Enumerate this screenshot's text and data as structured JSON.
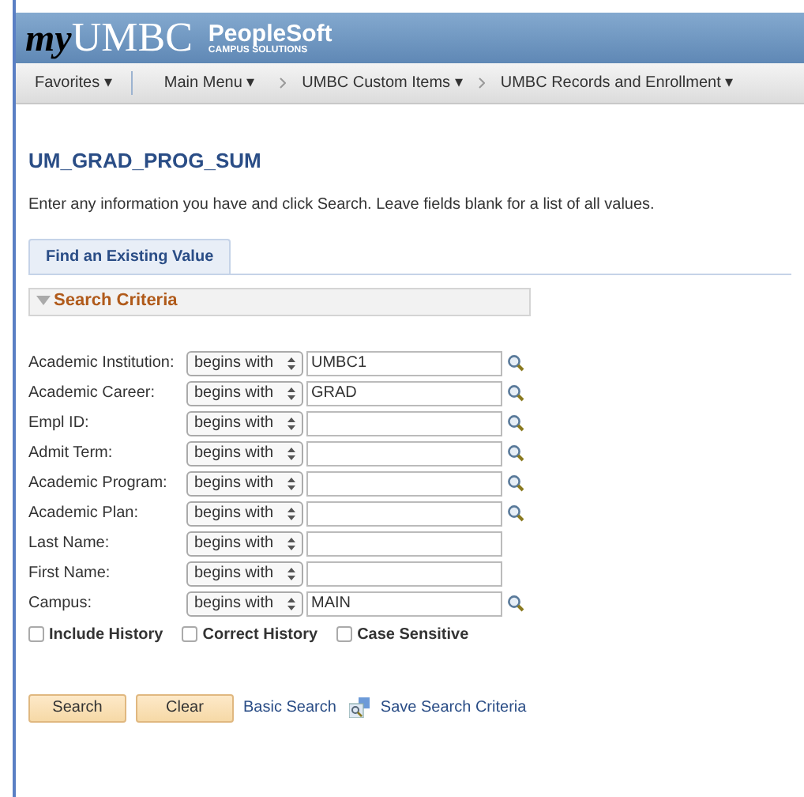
{
  "header": {
    "logo_my": "my",
    "logo_umbc": "UMBC",
    "product": "PeopleSoft",
    "product_sub": "CAMPUS SOLUTIONS"
  },
  "nav": [
    {
      "label": "Favorites ▾",
      "breadcrumb": false
    },
    {
      "label": "Main Menu ▾",
      "breadcrumb": false
    },
    {
      "label": "UMBC Custom Items ▾",
      "breadcrumb": true
    },
    {
      "label": "UMBC Records and Enrollment ▾",
      "breadcrumb": true
    }
  ],
  "page_title": "UM_GRAD_PROG_SUM",
  "instructions": "Enter any information you have and click Search. Leave fields blank for a list of all values.",
  "tabs": [
    {
      "label": "Find an Existing Value",
      "selected": true
    }
  ],
  "section": {
    "title": "Search Criteria",
    "expanded": true
  },
  "fields": [
    {
      "label": "Academic Institution:",
      "operator": "begins with",
      "value": "UMBC1",
      "lookup": true
    },
    {
      "label": "Academic Career:",
      "operator": "begins with",
      "value": "GRAD",
      "lookup": true
    },
    {
      "label": "Empl ID:",
      "operator": "begins with",
      "lookup": true
    },
    {
      "label": "Admit Term:",
      "operator": "begins with",
      "lookup": true
    },
    {
      "label": "Academic Program:",
      "operator": "begins with",
      "lookup": true
    },
    {
      "label": "Academic Plan:",
      "operator": "begins with",
      "lookup": true
    },
    {
      "label": "Last Name:",
      "operator": "begins with",
      "lookup": false
    },
    {
      "label": "First Name:",
      "operator": "begins with",
      "lookup": false
    },
    {
      "label": "Campus:",
      "operator": "begins with",
      "value": "MAIN",
      "lookup": true
    }
  ],
  "options": [
    {
      "label": "Include History",
      "checked": false
    },
    {
      "label": "Correct History",
      "checked": false
    },
    {
      "label": "Case Sensitive",
      "checked": false
    }
  ],
  "buttons": [
    "Search",
    "Clear"
  ],
  "links": [
    "Basic Search",
    "Save Search Criteria"
  ]
}
